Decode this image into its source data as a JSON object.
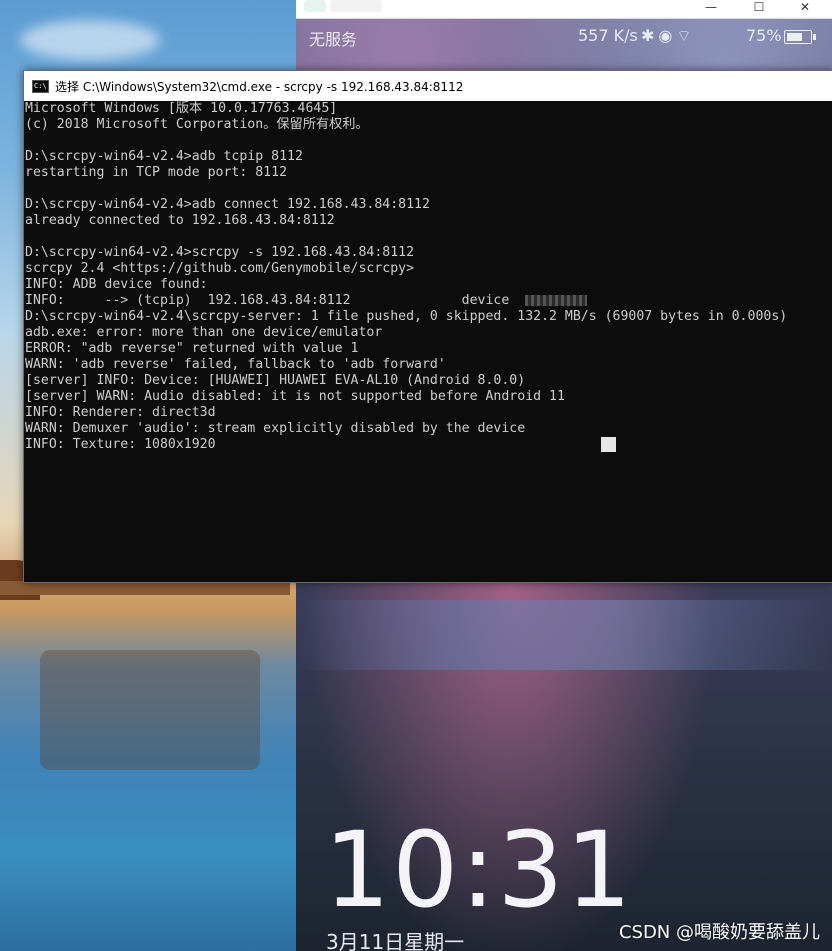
{
  "phone_mirror": {
    "carrier": "无服务",
    "net_speed": "557 K/s",
    "status_icons": "✱◉⌔",
    "battery": "75%",
    "battery_level": 0.75,
    "clock": "10:31",
    "date": "3月11日星期一",
    "window_controls": {
      "minimize": "—",
      "maximize": "☐",
      "close": "✕"
    }
  },
  "cmd": {
    "title": "选择 C:\\Windows\\System32\\cmd.exe - scrcpy  -s 192.168.43.84:8112",
    "icon_text": "C:\\",
    "lines": [
      "Microsoft Windows [版本 10.0.17763.4645]",
      "(c) 2018 Microsoft Corporation。保留所有权利。",
      "",
      "D:\\scrcpy-win64-v2.4>adb tcpip 8112",
      "restarting in TCP mode port: 8112",
      "",
      "D:\\scrcpy-win64-v2.4>adb connect 192.168.43.84:8112",
      "already connected to 192.168.43.84:8112",
      "",
      "D:\\scrcpy-win64-v2.4>scrcpy -s 192.168.43.84:8112",
      "scrcpy 2.4 <https://github.com/Genymobile/scrcpy>",
      "INFO: ADB device found:",
      "INFO:     --> (tcpip)  192.168.43.84:8112              device  ",
      "D:\\scrcpy-win64-v2.4\\scrcpy-server: 1 file pushed, 0 skipped. 132.2 MB/s (69007 bytes in 0.000s)",
      "adb.exe: error: more than one device/emulator",
      "ERROR: \"adb reverse\" returned with value 1",
      "WARN: 'adb reverse' failed, fallback to 'adb forward'",
      "[server] INFO: Device: [HUAWEI] HUAWEI EVA-AL10 (Android 8.0.0)",
      "[server] WARN: Audio disabled: it is not supported before Android 11",
      "INFO: Renderer: direct3d",
      "WARN: Demuxer 'audio': stream explicitly disabled by the device",
      "INFO: Texture: 1080x1920"
    ]
  },
  "watermark": "CSDN @喝酸奶要舔盖儿"
}
